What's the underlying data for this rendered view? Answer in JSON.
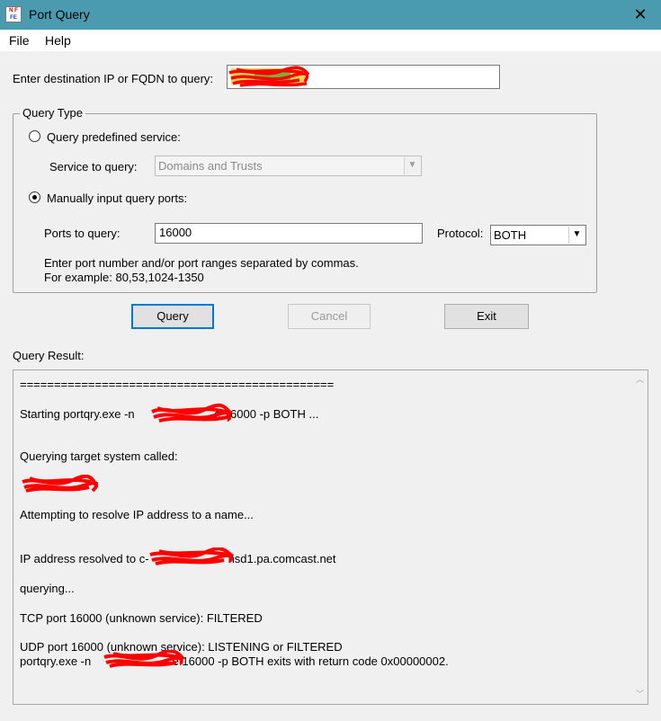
{
  "window": {
    "title": "Port Query",
    "close_glyph": "✕",
    "icon": {
      "name": "portqry-app-icon",
      "row1": "N F",
      "row2": "FE"
    }
  },
  "menu": {
    "items": [
      "File",
      "Help"
    ]
  },
  "destination": {
    "label": "Enter destination IP or FQDN to query:",
    "value": ""
  },
  "query_type": {
    "legend": "Query Type",
    "predefined": {
      "label": "Query predefined service:",
      "selected": false,
      "service_label": "Service to query:",
      "service_value": "Domains and Trusts"
    },
    "manual": {
      "label": "Manually input query ports:",
      "selected": true,
      "ports_label": "Ports to query:",
      "ports_value": "16000",
      "protocol_label": "Protocol:",
      "protocol_value": "BOTH",
      "help_line1": "Enter port number and/or port ranges separated by commas.",
      "help_line2": "For example: 80,53,1024-1350"
    }
  },
  "buttons": {
    "query": "Query",
    "cancel": "Cancel",
    "exit": "Exit"
  },
  "result": {
    "label": "Query Result:",
    "lines": {
      "separator": "==============================================",
      "starting_prefix": " Starting portqry.exe -n",
      "starting_suffix": "-e 16000 -p BOTH ...",
      "querying_target": "Querying target system called:",
      "resolving": "Attempting to resolve IP address to a name...",
      "resolved_prefix": "IP address resolved to c-",
      "resolved_suffix": "hsd1.pa.comcast.net",
      "querying": "querying...",
      "tcp": "TCP port 16000 (unknown service): FILTERED",
      "udp": "UDP port 16000 (unknown service): LISTENING or FILTERED",
      "exit_prefix": "portqry.exe -n",
      "exit_suffix": "-e 16000 -p BOTH exits with return code 0x00000002."
    }
  },
  "colors": {
    "titlebar": "#4a9ab0",
    "redaction": "#ff0000",
    "default_button_border": "#0078d7"
  }
}
